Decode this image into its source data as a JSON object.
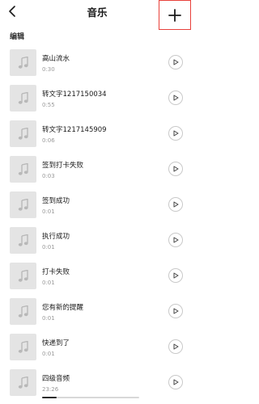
{
  "header": {
    "title": "音乐",
    "back_icon": "back-chevron-icon",
    "add_icon": "plus-icon"
  },
  "edit_label": "编辑",
  "icons": {
    "thumb": "music-note-icon",
    "play": "play-icon"
  },
  "colors": {
    "highlight_border": "#e8413b",
    "thumb_bg": "#e4e4e4",
    "duration_text": "#9a9a9a"
  },
  "sounds": [
    {
      "name": "高山流水",
      "duration": "0:30"
    },
    {
      "name": "转文字1217150034",
      "duration": "0:55"
    },
    {
      "name": "转文字1217145909",
      "duration": "0:06"
    },
    {
      "name": "签到打卡失败",
      "duration": "0:03"
    },
    {
      "name": "签到成功",
      "duration": "0:01"
    },
    {
      "name": "执行成功",
      "duration": "0:01"
    },
    {
      "name": "打卡失败",
      "duration": "0:01"
    },
    {
      "name": "您有新的提醒",
      "duration": "0:01"
    },
    {
      "name": "快递到了",
      "duration": "0:01"
    },
    {
      "name": "四级音频",
      "duration": "23:26"
    }
  ],
  "playback": {
    "progress": 0.15
  }
}
